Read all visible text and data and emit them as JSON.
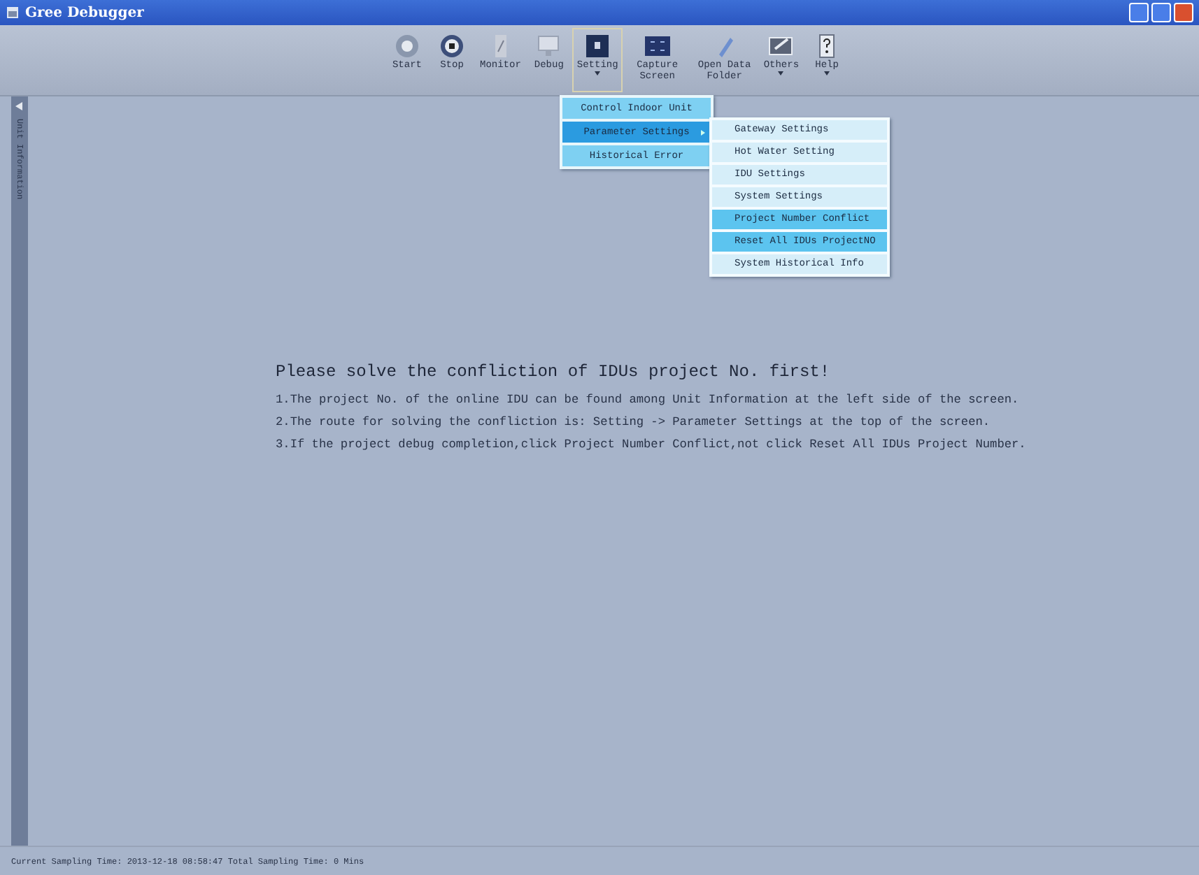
{
  "window": {
    "title": "Gree Debugger"
  },
  "toolbar": [
    {
      "label": "Start",
      "kind": "start",
      "selected": false,
      "dropdown": false
    },
    {
      "label": "Stop",
      "kind": "stop",
      "selected": false,
      "dropdown": false
    },
    {
      "label": "Monitor",
      "kind": "monitor",
      "selected": false,
      "dropdown": false
    },
    {
      "label": "Debug",
      "kind": "debug",
      "selected": false,
      "dropdown": false
    },
    {
      "label": "Setting",
      "kind": "setting",
      "selected": true,
      "dropdown": true
    },
    {
      "label": "Capture Screen",
      "kind": "capture",
      "selected": false,
      "dropdown": false
    },
    {
      "label": "Open Data Folder",
      "kind": "folder",
      "selected": false,
      "dropdown": false
    },
    {
      "label": "Others",
      "kind": "others",
      "selected": false,
      "dropdown": true
    },
    {
      "label": "Help",
      "kind": "help",
      "selected": false,
      "dropdown": true
    }
  ],
  "setting_menu": [
    {
      "label": "Control Indoor Unit",
      "selected": false,
      "submenu": false
    },
    {
      "label": "Parameter Settings",
      "selected": true,
      "submenu": true
    },
    {
      "label": "Historical Error",
      "selected": false,
      "submenu": false
    }
  ],
  "parameter_submenu": [
    {
      "label": "Gateway Settings",
      "selected": false
    },
    {
      "label": "Hot Water Setting",
      "selected": false
    },
    {
      "label": "IDU Settings",
      "selected": false
    },
    {
      "label": "System Settings",
      "selected": false
    },
    {
      "label": "Project Number Conflict",
      "selected": true
    },
    {
      "label": "Reset All IDUs ProjectNO",
      "selected": true
    },
    {
      "label": "System Historical Info",
      "selected": false
    }
  ],
  "side_panel": {
    "label": "Unit Information"
  },
  "message": {
    "heading": "Please solve the confliction of IDUs project No. first!",
    "lines": [
      "1.The project No. of the online IDU can be found among Unit Information at the left side of the screen.",
      "2.The route for solving the confliction is: Setting -> Parameter Settings at the top of the screen.",
      "3.If the project debug completion,click Project Number Conflict,not click Reset All IDUs Project Number."
    ]
  },
  "status_bar": {
    "text": "Current Sampling Time: 2013-12-18 08:58:47  Total Sampling Time: 0 Mins"
  }
}
